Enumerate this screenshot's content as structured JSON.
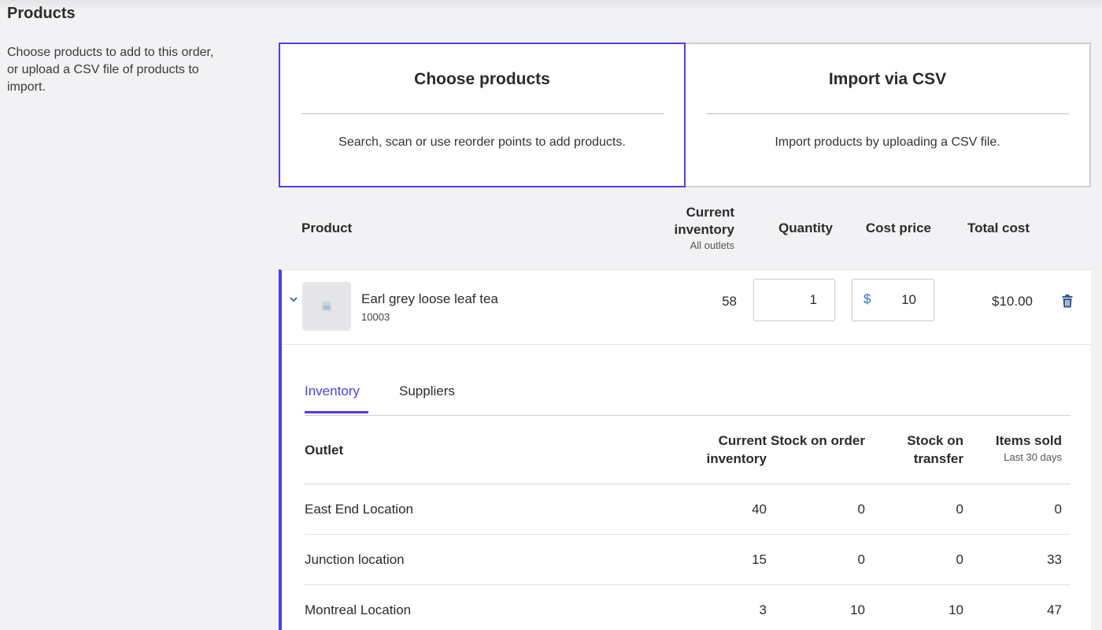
{
  "section": {
    "title": "Products",
    "description": "Choose products to add to this order, or upload a CSV file of products to import."
  },
  "modes": [
    {
      "title": "Choose products",
      "description": "Search, scan or use reorder points to add products.",
      "active": true
    },
    {
      "title": "Import via CSV",
      "description": "Import products by uploading a CSV file.",
      "active": false
    }
  ],
  "product_table": {
    "headers": {
      "product": "Product",
      "current_inventory": "Current inventory",
      "current_inventory_sub": "All outlets",
      "quantity": "Quantity",
      "cost_price": "Cost price",
      "total_cost": "Total cost"
    },
    "row": {
      "name": "Earl grey loose leaf tea",
      "sku": "10003",
      "current_inventory": "58",
      "quantity": "1",
      "currency_symbol": "$",
      "cost_price": "10",
      "total_cost": "$10.00"
    }
  },
  "detail_tabs": [
    {
      "label": "Inventory",
      "active": true
    },
    {
      "label": "Suppliers",
      "active": false
    }
  ],
  "outlets_table": {
    "headers": {
      "outlet": "Outlet",
      "current_inventory": "Current inventory",
      "stock_on_order": "Stock on order",
      "stock_on_transfer": "Stock on transfer",
      "items_sold": "Items sold",
      "items_sold_sub": "Last 30 days"
    },
    "rows": [
      {
        "outlet": "East End Location",
        "current_inventory": "40",
        "stock_on_order": "0",
        "stock_on_transfer": "0",
        "items_sold": "0"
      },
      {
        "outlet": "Junction location",
        "current_inventory": "15",
        "stock_on_order": "0",
        "stock_on_transfer": "0",
        "items_sold": "33"
      },
      {
        "outlet": "Montreal Location",
        "current_inventory": "3",
        "stock_on_order": "10",
        "stock_on_transfer": "10",
        "items_sold": "47"
      }
    ]
  },
  "icons": {
    "expand": "chevron-down-icon",
    "thumbnail": "image-placeholder-icon",
    "delete": "trash-icon"
  },
  "colors": {
    "accent": "#4b3ef0",
    "currency": "#2e6fd8",
    "background": "#f2f1f4",
    "trash": "#2f5a8f"
  }
}
